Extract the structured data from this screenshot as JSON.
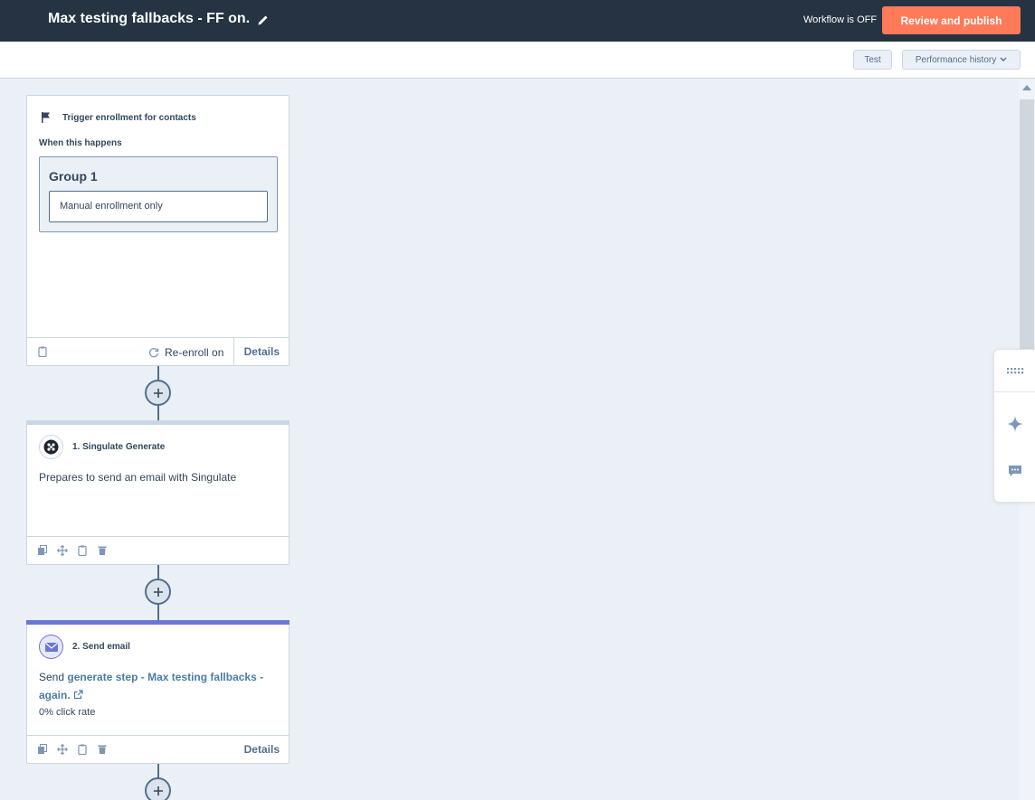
{
  "header": {
    "workflow_title": "Max testing fallbacks - FF on.",
    "status": "Workflow is OFF",
    "publish_label": "Review and publish"
  },
  "toolbar": {
    "test_label": "Test",
    "performance_label": "Performance history"
  },
  "trigger": {
    "title": "Trigger enrollment for contacts",
    "when_label": "When this happens",
    "group_title": "Group 1",
    "filter": "Manual enrollment only",
    "reenroll_label": "Re-enroll on",
    "details_label": "Details"
  },
  "actions": [
    {
      "title": "1. Singulate Generate",
      "description": "Prepares to send an email with Singulate",
      "topline_color": "#cbd6e2"
    },
    {
      "title": "2. Send email",
      "send_prefix": "Send",
      "email_link": "generate step - Max testing fallbacks - again.",
      "click_rate": "0% click rate",
      "details_label": "Details",
      "topline_color": "#6a78d1"
    }
  ],
  "colors": {
    "topbar": "#253342",
    "publish": "#ff7a59",
    "canvas": "#eaf0f6"
  }
}
